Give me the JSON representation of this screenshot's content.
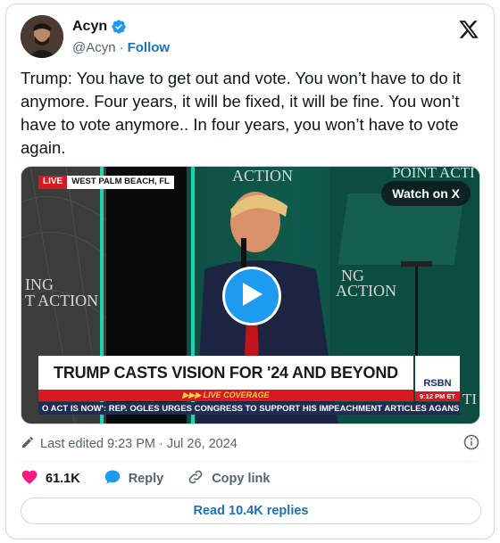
{
  "author": {
    "name": "Acyn",
    "handle": "@Acyn",
    "separator": "·",
    "follow_label": "Follow"
  },
  "tweet": {
    "text": "Trump: You have to get out and vote. You won’t have to do it anymore. Four years, it will be fixed, it will be fine. You won’t have to vote anymore.. In four years, you won’t have to vote again."
  },
  "video": {
    "live_label": "LIVE",
    "location": "WEST PALM BEACH, FL",
    "watch_label": "Watch on X",
    "headline": "TRUMP CASTS VISION FOR '24 AND BEYOND",
    "live_coverage": "▶▶▶ LIVE COVERAGE",
    "network": "RSBN",
    "network_time": "9:12 PM ET",
    "ticker": "O ACT IS NOW': REP. OGLES URGES CONGRESS TO SUPPORT HIS IMPEACHMENT ARTICLES AGANS",
    "backdrop_left": [
      "ING",
      "T ACTION"
    ],
    "backdrop_center": "ACTION",
    "backdrop_right": [
      "NG",
      "ACTION"
    ],
    "backdrop_top_right": "POINT ACTI",
    "backdrop_bottom_right": "TI"
  },
  "meta": {
    "edited": "Last edited 9:23 PM · Jul 26, 2024"
  },
  "actions": {
    "likes": "61.1K",
    "reply_label": "Reply",
    "copy_label": "Copy link"
  },
  "read_replies": "Read 10.4K replies",
  "colors": {
    "accent": "#1d9bf0",
    "link": "#1d72b8",
    "like": "#f91880",
    "muted": "#536471",
    "live_red": "#d71a21"
  },
  "icons": [
    "verified-badge-icon",
    "x-logo-icon",
    "play-icon",
    "pencil-icon",
    "info-icon",
    "heart-icon",
    "reply-bubble-icon",
    "link-icon"
  ]
}
